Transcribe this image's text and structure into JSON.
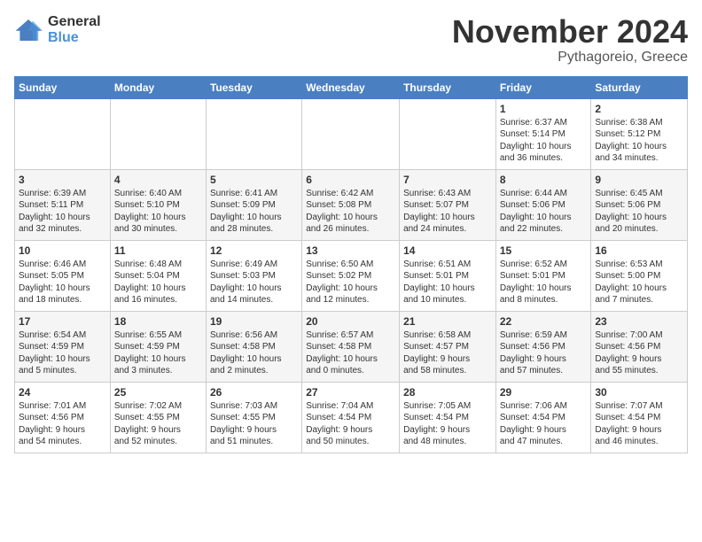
{
  "logo": {
    "general": "General",
    "blue": "Blue"
  },
  "title": "November 2024",
  "location": "Pythagoreio, Greece",
  "headers": [
    "Sunday",
    "Monday",
    "Tuesday",
    "Wednesday",
    "Thursday",
    "Friday",
    "Saturday"
  ],
  "weeks": [
    [
      {
        "day": "",
        "info": ""
      },
      {
        "day": "",
        "info": ""
      },
      {
        "day": "",
        "info": ""
      },
      {
        "day": "",
        "info": ""
      },
      {
        "day": "",
        "info": ""
      },
      {
        "day": "1",
        "info": "Sunrise: 6:37 AM\nSunset: 5:14 PM\nDaylight: 10 hours\nand 36 minutes."
      },
      {
        "day": "2",
        "info": "Sunrise: 6:38 AM\nSunset: 5:12 PM\nDaylight: 10 hours\nand 34 minutes."
      }
    ],
    [
      {
        "day": "3",
        "info": "Sunrise: 6:39 AM\nSunset: 5:11 PM\nDaylight: 10 hours\nand 32 minutes."
      },
      {
        "day": "4",
        "info": "Sunrise: 6:40 AM\nSunset: 5:10 PM\nDaylight: 10 hours\nand 30 minutes."
      },
      {
        "day": "5",
        "info": "Sunrise: 6:41 AM\nSunset: 5:09 PM\nDaylight: 10 hours\nand 28 minutes."
      },
      {
        "day": "6",
        "info": "Sunrise: 6:42 AM\nSunset: 5:08 PM\nDaylight: 10 hours\nand 26 minutes."
      },
      {
        "day": "7",
        "info": "Sunrise: 6:43 AM\nSunset: 5:07 PM\nDaylight: 10 hours\nand 24 minutes."
      },
      {
        "day": "8",
        "info": "Sunrise: 6:44 AM\nSunset: 5:06 PM\nDaylight: 10 hours\nand 22 minutes."
      },
      {
        "day": "9",
        "info": "Sunrise: 6:45 AM\nSunset: 5:06 PM\nDaylight: 10 hours\nand 20 minutes."
      }
    ],
    [
      {
        "day": "10",
        "info": "Sunrise: 6:46 AM\nSunset: 5:05 PM\nDaylight: 10 hours\nand 18 minutes."
      },
      {
        "day": "11",
        "info": "Sunrise: 6:48 AM\nSunset: 5:04 PM\nDaylight: 10 hours\nand 16 minutes."
      },
      {
        "day": "12",
        "info": "Sunrise: 6:49 AM\nSunset: 5:03 PM\nDaylight: 10 hours\nand 14 minutes."
      },
      {
        "day": "13",
        "info": "Sunrise: 6:50 AM\nSunset: 5:02 PM\nDaylight: 10 hours\nand 12 minutes."
      },
      {
        "day": "14",
        "info": "Sunrise: 6:51 AM\nSunset: 5:01 PM\nDaylight: 10 hours\nand 10 minutes."
      },
      {
        "day": "15",
        "info": "Sunrise: 6:52 AM\nSunset: 5:01 PM\nDaylight: 10 hours\nand 8 minutes."
      },
      {
        "day": "16",
        "info": "Sunrise: 6:53 AM\nSunset: 5:00 PM\nDaylight: 10 hours\nand 7 minutes."
      }
    ],
    [
      {
        "day": "17",
        "info": "Sunrise: 6:54 AM\nSunset: 4:59 PM\nDaylight: 10 hours\nand 5 minutes."
      },
      {
        "day": "18",
        "info": "Sunrise: 6:55 AM\nSunset: 4:59 PM\nDaylight: 10 hours\nand 3 minutes."
      },
      {
        "day": "19",
        "info": "Sunrise: 6:56 AM\nSunset: 4:58 PM\nDaylight: 10 hours\nand 2 minutes."
      },
      {
        "day": "20",
        "info": "Sunrise: 6:57 AM\nSunset: 4:58 PM\nDaylight: 10 hours\nand 0 minutes."
      },
      {
        "day": "21",
        "info": "Sunrise: 6:58 AM\nSunset: 4:57 PM\nDaylight: 9 hours\nand 58 minutes."
      },
      {
        "day": "22",
        "info": "Sunrise: 6:59 AM\nSunset: 4:56 PM\nDaylight: 9 hours\nand 57 minutes."
      },
      {
        "day": "23",
        "info": "Sunrise: 7:00 AM\nSunset: 4:56 PM\nDaylight: 9 hours\nand 55 minutes."
      }
    ],
    [
      {
        "day": "24",
        "info": "Sunrise: 7:01 AM\nSunset: 4:56 PM\nDaylight: 9 hours\nand 54 minutes."
      },
      {
        "day": "25",
        "info": "Sunrise: 7:02 AM\nSunset: 4:55 PM\nDaylight: 9 hours\nand 52 minutes."
      },
      {
        "day": "26",
        "info": "Sunrise: 7:03 AM\nSunset: 4:55 PM\nDaylight: 9 hours\nand 51 minutes."
      },
      {
        "day": "27",
        "info": "Sunrise: 7:04 AM\nSunset: 4:54 PM\nDaylight: 9 hours\nand 50 minutes."
      },
      {
        "day": "28",
        "info": "Sunrise: 7:05 AM\nSunset: 4:54 PM\nDaylight: 9 hours\nand 48 minutes."
      },
      {
        "day": "29",
        "info": "Sunrise: 7:06 AM\nSunset: 4:54 PM\nDaylight: 9 hours\nand 47 minutes."
      },
      {
        "day": "30",
        "info": "Sunrise: 7:07 AM\nSunset: 4:54 PM\nDaylight: 9 hours\nand 46 minutes."
      }
    ]
  ]
}
